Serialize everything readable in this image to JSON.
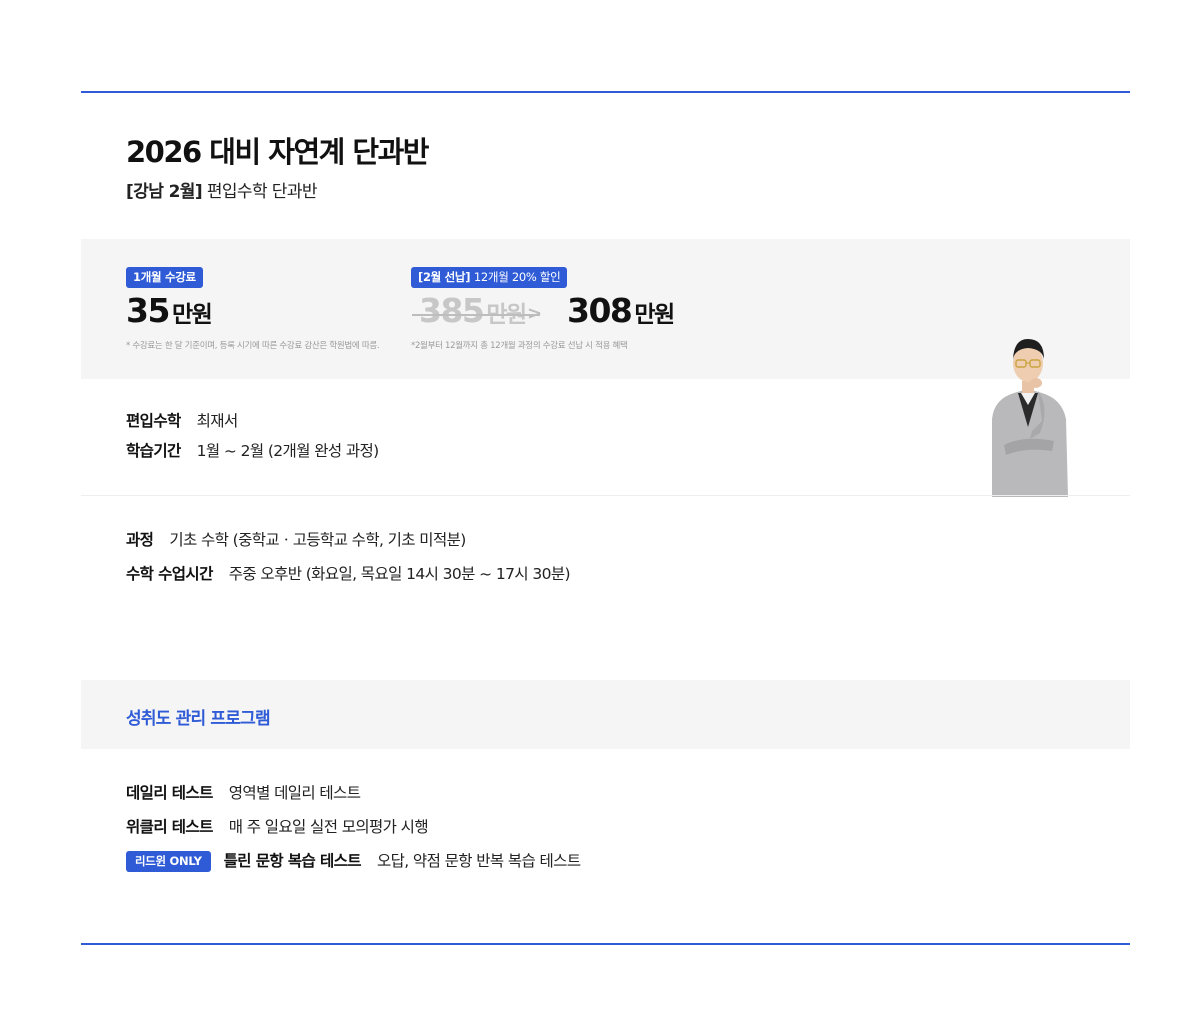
{
  "header": {
    "title": "2026 대비 자연계 단과반",
    "subtitle_tag": "[강남 2월]",
    "subtitle_text": "편입수학 단과반"
  },
  "pricing": {
    "monthly": {
      "badge": "1개월 수강료",
      "amount": "35",
      "unit": "만원",
      "note": "* 수강료는 한 달 기준이며, 등록 시기에 따른 수강료 감산은 학원법에 따름."
    },
    "prepay": {
      "badge_bold": "[2월 선납]",
      "badge_text": "12개월 20% 할인",
      "old_amount": "385",
      "old_unit": "만원",
      "arrow": ">",
      "new_amount": "308",
      "new_unit": "만원",
      "note": "*2월부터 12월까지 총 12개월 과정의 수강료 선납 시 적용 혜택"
    }
  },
  "details": [
    {
      "label": "편입수학",
      "value": "최재서"
    },
    {
      "label": "학습기간",
      "value": "1월 ~ 2월 (2개월 완성 과정)"
    }
  ],
  "course": [
    {
      "label": "과정",
      "value": "기초 수학 (중학교ㆍ고등학교 수학, 기초 미적분)"
    },
    {
      "label": "수학 수업시간",
      "value": "주중 오후반 (화요일, 목요일 14시 30분 ~ 17시 30분)"
    }
  ],
  "program": {
    "title": "성취도 관리 프로그램",
    "items": [
      {
        "label": "데일리 테스트",
        "value": "영역별 데일리 테스트"
      },
      {
        "label": "위클리 테스트",
        "value": "매 주 일요일 실전 모의평가 시행"
      },
      {
        "badge": "리드윈 ONLY",
        "label": "틀린 문항 복습 테스트",
        "value": "오답, 약점 문항 반복 복습 테스트"
      }
    ]
  },
  "colors": {
    "accent": "#2f5bd6",
    "panel": "#f5f5f5",
    "text": "#222222",
    "muted": "#9a9a9a"
  },
  "icons": {
    "teacher_photo": "teacher-portrait-image"
  }
}
